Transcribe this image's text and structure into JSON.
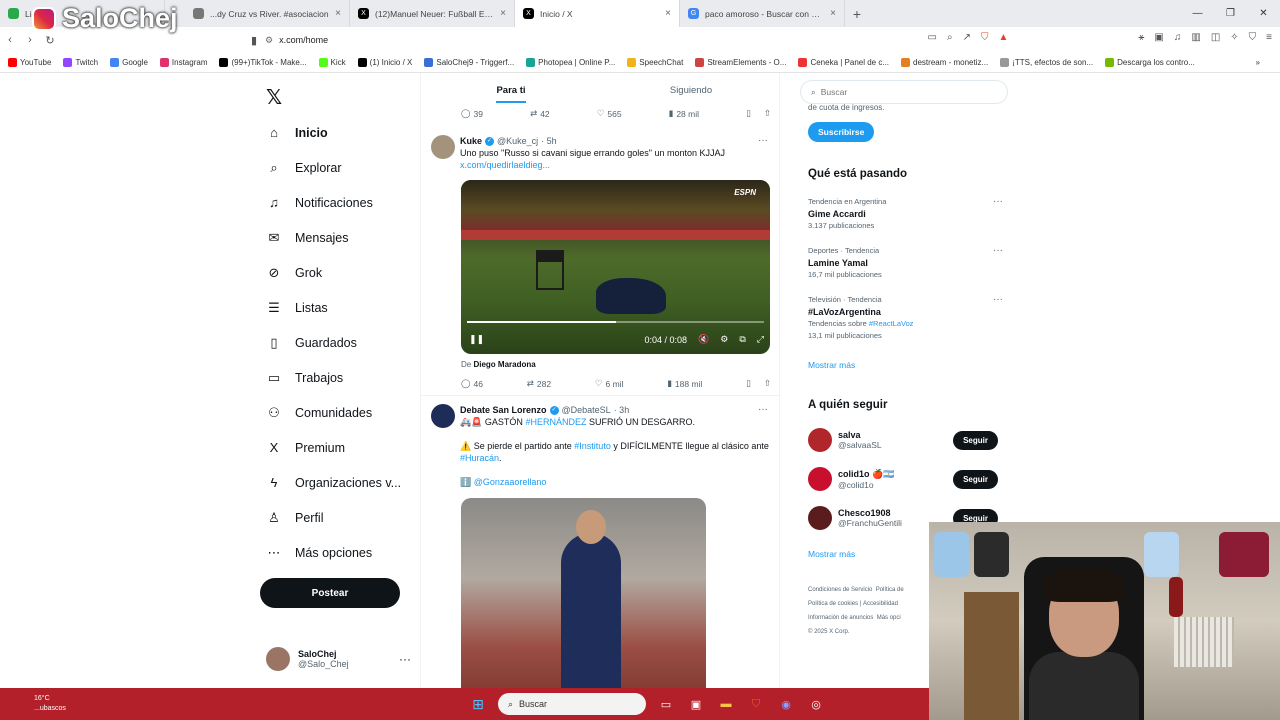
{
  "overlay": {
    "brand": "SaloChej"
  },
  "browser": {
    "tabs": [
      {
        "title": "Lista ...",
        "color": "#2aa84a"
      },
      {
        "title": "...",
        "color": "#777777"
      },
      {
        "title": "...dy Cruz vs River. #asociacion",
        "color": "#777777"
      },
      {
        "title": "(12)Manuel Neuer: Fußball Edits und",
        "color": "#000000"
      },
      {
        "title": "Inicio / X",
        "color": "#000000"
      },
      {
        "title": "paco amoroso - Buscar con Google",
        "color": "#4285f4"
      }
    ],
    "url": "x.com/home",
    "bookmarks": [
      {
        "label": "YouTube",
        "color": "#ff0000"
      },
      {
        "label": "Twitch",
        "color": "#9146ff"
      },
      {
        "label": "Google",
        "color": "#4285f4"
      },
      {
        "label": "Instagram",
        "color": "#e1306c"
      },
      {
        "label": "(99+)TikTok - Make...",
        "color": "#000000"
      },
      {
        "label": "Kick",
        "color": "#53fc18"
      },
      {
        "label": "(1) Inicio / X",
        "color": "#000000"
      },
      {
        "label": "SaloChej9 - Triggerf...",
        "color": "#3b6fd8"
      },
      {
        "label": "Photopea | Online P...",
        "color": "#18a497"
      },
      {
        "label": "SpeechChat",
        "color": "#f2b21b"
      },
      {
        "label": "StreamElements - O...",
        "color": "#c44"
      },
      {
        "label": "Ceneka | Panel de c...",
        "color": "#e33"
      },
      {
        "label": "destream - monetiz...",
        "color": "#e67e22"
      },
      {
        "label": "¡TTS, efectos de son...",
        "color": "#999999"
      },
      {
        "label": "Descarga los contro...",
        "color": "#76b900"
      }
    ]
  },
  "sidebar": {
    "items": [
      {
        "label": "Inicio",
        "icon": "⌂"
      },
      {
        "label": "Explorar",
        "icon": "⌕"
      },
      {
        "label": "Notificaciones",
        "icon": "♫"
      },
      {
        "label": "Mensajes",
        "icon": "✉"
      },
      {
        "label": "Grok",
        "icon": "⊘"
      },
      {
        "label": "Listas",
        "icon": "☰"
      },
      {
        "label": "Guardados",
        "icon": "▯"
      },
      {
        "label": "Trabajos",
        "icon": "▭"
      },
      {
        "label": "Comunidades",
        "icon": "⚇"
      },
      {
        "label": "Premium",
        "icon": "X"
      },
      {
        "label": "Organizaciones v...",
        "icon": "ϟ"
      },
      {
        "label": "Perfil",
        "icon": "♙"
      },
      {
        "label": "Más opciones",
        "icon": "⋯"
      }
    ],
    "post_label": "Postear",
    "user": {
      "name": "SaloChej",
      "handle": "@Salo_Chej"
    }
  },
  "feed": {
    "tabs": [
      "Para ti",
      "Siguiendo"
    ],
    "prev_actions": {
      "replies": "39",
      "reposts": "42",
      "likes": "565",
      "views": "28 mil"
    },
    "tweet1": {
      "name": "Kuke",
      "handle": "@Kuke_cj",
      "time": "· 5h",
      "text": "Uno puso \"Russo si cavani sigue errando goles\" un monton KJJAJ",
      "link": "x.com/quedirlaeldieg...",
      "video_logo": "ESPN",
      "video_time": "0:04 / 0:08",
      "video_progress": 0.5,
      "source_prefix": "De",
      "source_name": "Diego Maradona",
      "replies": "46",
      "reposts": "282",
      "likes": "6 mil",
      "views": "188 mil"
    },
    "tweet2": {
      "name": "Debate San Lorenzo",
      "handle": "@DebateSL",
      "time": "· 3h",
      "line1_prefix": "🚑🚨 GASTÓN",
      "line1_tag": "#HERNÁNDEZ",
      "line1_suffix": "SUFRIÓ UN DESGARRO.",
      "line2_prefix": "⚠️ Se pierde el partido ante",
      "line2_tag": "#Instituto",
      "line2_mid": "y DIFÍCILMENTE llegue al clásico ante",
      "line2_tag2": "#Huracán",
      "line2_end": ".",
      "mention_prefix": "ℹ️",
      "mention": "@Gonzaaorellano"
    }
  },
  "right": {
    "search_placeholder": "Buscar",
    "premium_tail": "de cuota de ingresos.",
    "subscribe": "Suscribirse",
    "trends_title": "Qué está pasando",
    "trends": [
      {
        "context": "Tendencia en Argentina",
        "name": "Gime Accardi",
        "count": "3.137 publicaciones"
      },
      {
        "context": "Deportes · Tendencia",
        "name": "Lamine Yamal",
        "count": "16,7 mil publicaciones"
      },
      {
        "context": "Televisión · Tendencia",
        "name": "#LaVozArgentina",
        "extra_prefix": "Tendencias sobre",
        "extra_tag": "#ReactLaVoz",
        "count": "13,1 mil publicaciones"
      }
    ],
    "show_more": "Mostrar más",
    "follow_title": "A quién seguir",
    "follow": [
      {
        "name": "salva",
        "handle": "@salvaaSL",
        "button": "Seguir",
        "color": "#b1262a"
      },
      {
        "name": "colid1o 🍎🇦🇷",
        "handle": "@colid1o",
        "button": "Seguir",
        "color": "#c8102e"
      },
      {
        "name": "Chesco1908",
        "handle": "@FranchuGentili",
        "button": "Seguir",
        "color": "#5a1c1c"
      }
    ],
    "show_more2": "Mostrar más",
    "footer": [
      "Condiciones de Servicio",
      "Política de",
      "Política de cookies",
      "Accesibilidad",
      "Información de anuncios",
      "Más opci",
      "© 2025 X Corp."
    ]
  },
  "taskbar": {
    "temp": "16°C",
    "weather": "...ubascos",
    "search": "Buscar"
  }
}
